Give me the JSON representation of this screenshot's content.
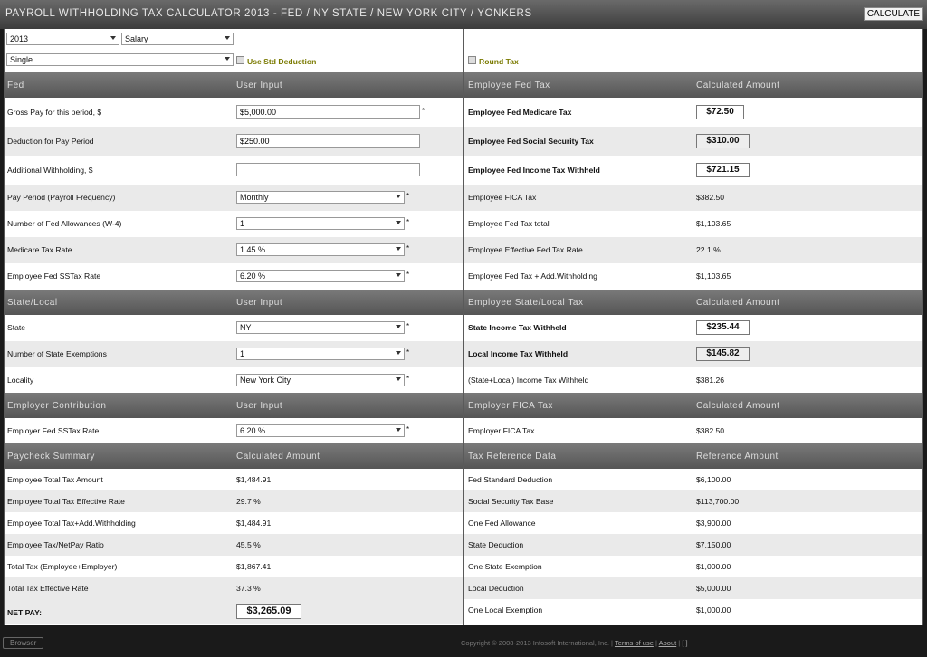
{
  "title": "PAYROLL WITHHOLDING TAX CALCULATOR 2013 - FED / NY STATE / NEW YORK CITY / YONKERS",
  "calculate_label": "CALCULATE",
  "top": {
    "year": "2013",
    "pay_type": "Salary",
    "filing_status": "Single",
    "use_std_deduction": "Use Std Deduction",
    "round_tax": "Round Tax"
  },
  "fed": {
    "header": "Fed",
    "header_input": "User Input",
    "gross_pay_label": "Gross Pay for this period, $",
    "gross_pay_value": "$5,000.00",
    "deduction_label": "Deduction for Pay Period",
    "deduction_value": "$250.00",
    "add_withholding_label": "Additional Withholding, $",
    "add_withholding_value": "",
    "pay_period_label": "Pay Period (Payroll Frequency)",
    "pay_period_value": "Monthly",
    "allowances_label": "Number of Fed Allowances (W-4)",
    "allowances_value": "1",
    "medicare_rate_label": "Medicare Tax Rate",
    "medicare_rate_value": "1.45 %",
    "ss_rate_label": "Employee Fed SSTax Rate",
    "ss_rate_value": "6.20 %",
    "required": "*"
  },
  "emp_fed": {
    "header": "Employee Fed Tax",
    "header_calc": "Calculated Amount",
    "medicare_label": "Employee Fed Medicare Tax",
    "medicare_value": "$72.50",
    "ss_label": "Employee Fed Social Security Tax",
    "ss_value": "$310.00",
    "income_label": "Employee Fed Income Tax Withheld",
    "income_value": "$721.15",
    "fica_label": "Employee FICA Tax",
    "fica_value": "$382.50",
    "total_label": "Employee Fed Tax total",
    "total_value": "$1,103.65",
    "eff_label": "Employee Effective Fed Tax Rate",
    "eff_value": "22.1 %",
    "plus_label": "Employee Fed Tax + Add.Withholding",
    "plus_value": "$1,103.65"
  },
  "state": {
    "header": "State/Local",
    "header_input": "User Input",
    "state_label": "State",
    "state_value": "NY",
    "exemptions_label": "Number of State Exemptions",
    "exemptions_value": "1",
    "locality_label": "Locality",
    "locality_value": "New York City"
  },
  "emp_state": {
    "header": "Employee State/Local Tax",
    "header_calc": "Calculated Amount",
    "state_label": "State Income Tax Withheld",
    "state_value": "$235.44",
    "local_label": "Local Income Tax Withheld",
    "local_value": "$145.82",
    "sum_label": "(State+Local) Income Tax Withheld",
    "sum_value": "$381.26"
  },
  "employer": {
    "header": "Employer Contribution",
    "header_input": "User Input",
    "ss_label": "Employer Fed SSTax Rate",
    "ss_value": "6.20 %"
  },
  "employer_fica": {
    "header": "Employer FICA Tax",
    "header_calc": "Calculated Amount",
    "label": "Employer FICA Tax",
    "value": "$382.50"
  },
  "summary": {
    "header": "Paycheck Summary",
    "header_calc": "Calculated Amount",
    "rows": [
      {
        "label": "Employee Total Tax Amount",
        "value": "$1,484.91"
      },
      {
        "label": "Employee Total Tax Effective Rate",
        "value": "29.7 %"
      },
      {
        "label": "Employee Total Tax+Add.Withholding",
        "value": "$1,484.91"
      },
      {
        "label": "Employee Tax/NetPay Ratio",
        "value": "45.5 %"
      },
      {
        "label": "Total Tax (Employee+Employer)",
        "value": "$1,867.41"
      },
      {
        "label": "Total Tax Effective Rate",
        "value": "37.3 %"
      }
    ],
    "net_pay_label": "NET PAY:",
    "net_pay_value": "$3,265.09"
  },
  "reference": {
    "header": "Tax Reference Data",
    "header_calc": "Reference Amount",
    "rows": [
      {
        "label": "Fed Standard Deduction",
        "value": "$6,100.00"
      },
      {
        "label": "Social Security Tax Base",
        "value": "$113,700.00"
      },
      {
        "label": "One Fed Allowance",
        "value": "$3,900.00"
      },
      {
        "label": "State Deduction",
        "value": "$7,150.00"
      },
      {
        "label": "One State Exemption",
        "value": "$1,000.00"
      },
      {
        "label": "Local Deduction",
        "value": "$5,000.00"
      },
      {
        "label": "One Local Exemption",
        "value": "$1,000.00"
      }
    ]
  },
  "footer": {
    "browser_label": "Browser",
    "copyright": "Copyright © 2008-2013 Infosoft International, Inc.",
    "terms": "Terms of use",
    "about": "About",
    "link3": "[ ]"
  }
}
